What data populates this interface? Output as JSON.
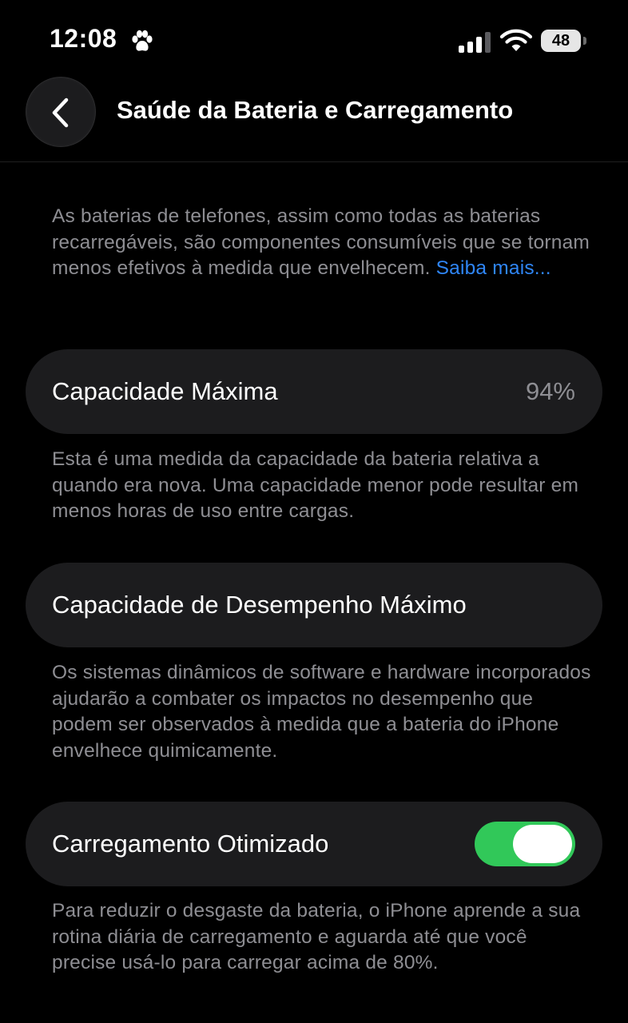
{
  "status_bar": {
    "time": "12:08",
    "battery_level": "48",
    "icons": [
      "paw-icon",
      "cellular-signal-icon",
      "wifi-icon",
      "battery-icon"
    ]
  },
  "header": {
    "back_icon": "chevron-left-icon",
    "title": "Saúde da Bateria e Carregamento"
  },
  "intro": {
    "text": "As baterias de telefones, assim como todas as baterias recarregáveis, são componentes consumíveis que se tornam menos efetivos à medida que envelhecem. ",
    "link": "Saiba mais..."
  },
  "max_capacity": {
    "label": "Capacidade Máxima",
    "value": "94%",
    "description": "Esta é uma medida da capacidade da bateria relativa a quando era nova. Uma capacidade menor pode resultar em menos horas de uso entre cargas."
  },
  "peak_performance": {
    "label": "Capacidade de Desempenho Máximo",
    "description": "Os sistemas dinâmicos de software e hardware incorporados ajudarão a combater os impactos no desempenho que podem ser observados à medida que a bateria do iPhone envelhece quimicamente."
  },
  "optimized_charging": {
    "label": "Carregamento Otimizado",
    "enabled": true,
    "description": "Para reduzir o desgaste da bateria, o iPhone aprende a sua rotina diária de carregamento e aguarda até que você precise usá-lo para carregar acima de 80%."
  },
  "colors": {
    "background": "#000000",
    "card": "#1c1c1e",
    "secondary_text": "#8e8e93",
    "link": "#2f86f6",
    "toggle_on": "#31c859"
  }
}
